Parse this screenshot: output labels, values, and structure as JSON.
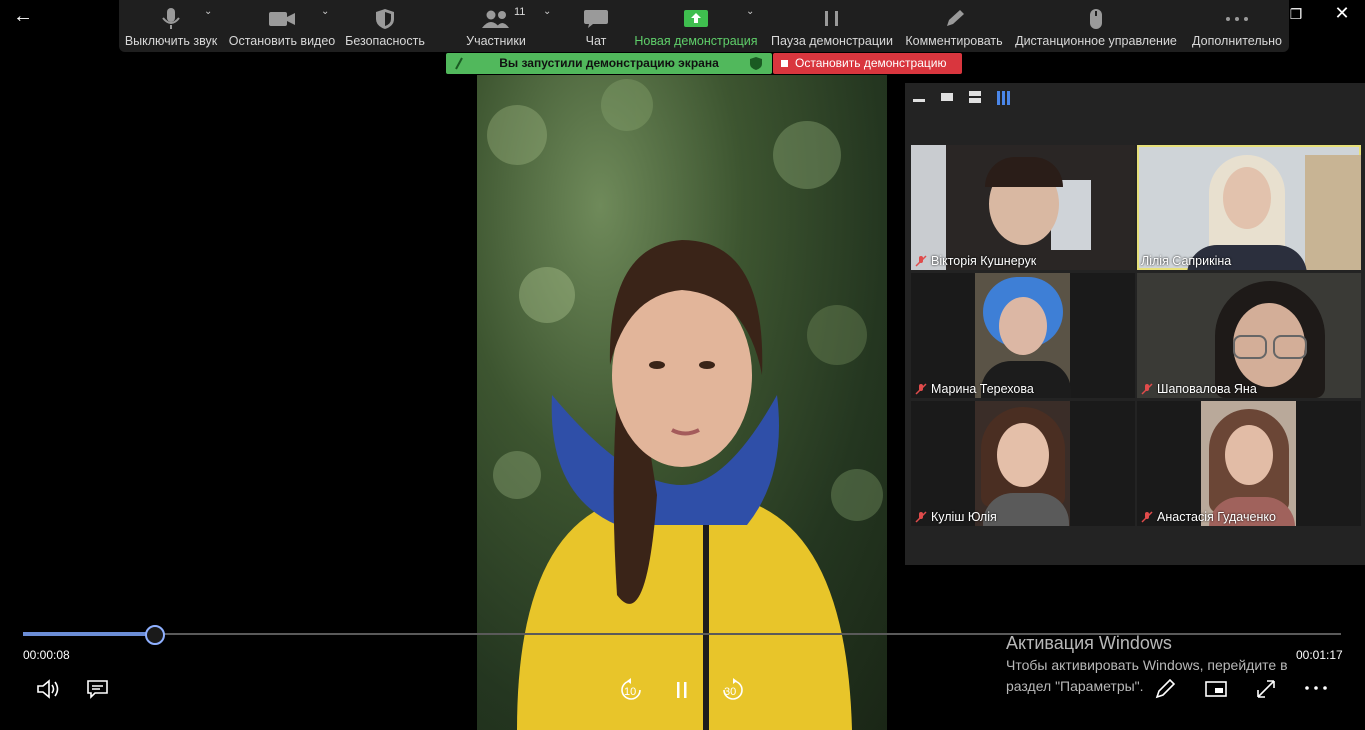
{
  "toolbar": {
    "mute_label": "Выключить звук",
    "video_label": "Остановить видео",
    "security_label": "Безопасность",
    "participants_label": "Участники",
    "participants_count": "11",
    "chat_label": "Чат",
    "new_share_label": "Новая демонстрация",
    "pause_share_label": "Пауза демонстрации",
    "annotate_label": "Комментировать",
    "remote_control_label": "Дистанционное управление",
    "more_label": "Дополнительно"
  },
  "share": {
    "banner_text": "Вы запустили демонстрацию экрана",
    "stop_label": "Остановить демонстрацию"
  },
  "participants": [
    {
      "name": "Вікторія Кушнерук"
    },
    {
      "name": "Лілія Саприкіна"
    },
    {
      "name": "Марина Терехова"
    },
    {
      "name": "Шаповалова Яна"
    },
    {
      "name": "Куліш Юлія"
    },
    {
      "name": "Анастасія Гудаченко"
    }
  ],
  "player": {
    "current_time": "00:00:08",
    "total_time": "00:01:17",
    "progress": 0.1,
    "rewind_label": "10",
    "forward_label": "30"
  },
  "watermark": {
    "title": "Активация Windows",
    "line1": "Чтобы активировать Windows, перейдите в",
    "line2": "раздел \"Параметры\"."
  },
  "colors": {
    "toolbar_bg": "#1f1f1f",
    "share_green": "#51b85c",
    "stop_red": "#d9363e",
    "active_speaker": "#e7e07a",
    "seek_fill": "#6b8dd6"
  }
}
